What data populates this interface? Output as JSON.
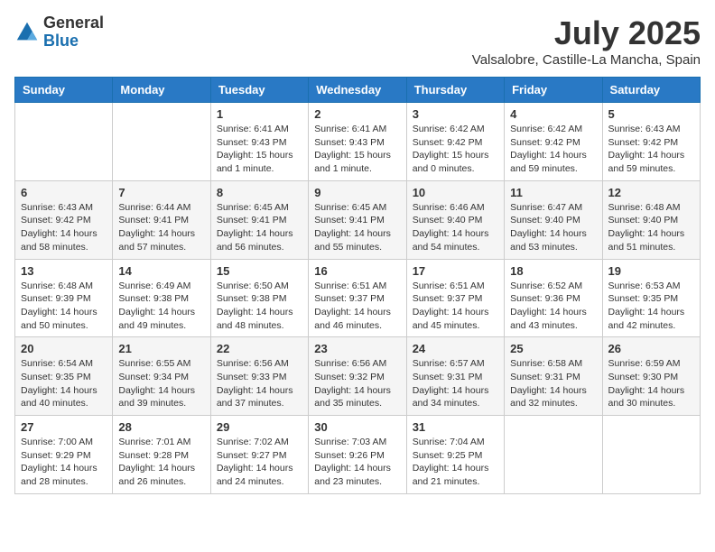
{
  "logo": {
    "general": "General",
    "blue": "Blue"
  },
  "title": "July 2025",
  "location": "Valsalobre, Castille-La Mancha, Spain",
  "days_of_week": [
    "Sunday",
    "Monday",
    "Tuesday",
    "Wednesday",
    "Thursday",
    "Friday",
    "Saturday"
  ],
  "weeks": [
    [
      {
        "day": "",
        "info": ""
      },
      {
        "day": "",
        "info": ""
      },
      {
        "day": "1",
        "info": "Sunrise: 6:41 AM\nSunset: 9:43 PM\nDaylight: 15 hours and 1 minute."
      },
      {
        "day": "2",
        "info": "Sunrise: 6:41 AM\nSunset: 9:43 PM\nDaylight: 15 hours and 1 minute."
      },
      {
        "day": "3",
        "info": "Sunrise: 6:42 AM\nSunset: 9:42 PM\nDaylight: 15 hours and 0 minutes."
      },
      {
        "day": "4",
        "info": "Sunrise: 6:42 AM\nSunset: 9:42 PM\nDaylight: 14 hours and 59 minutes."
      },
      {
        "day": "5",
        "info": "Sunrise: 6:43 AM\nSunset: 9:42 PM\nDaylight: 14 hours and 59 minutes."
      }
    ],
    [
      {
        "day": "6",
        "info": "Sunrise: 6:43 AM\nSunset: 9:42 PM\nDaylight: 14 hours and 58 minutes."
      },
      {
        "day": "7",
        "info": "Sunrise: 6:44 AM\nSunset: 9:41 PM\nDaylight: 14 hours and 57 minutes."
      },
      {
        "day": "8",
        "info": "Sunrise: 6:45 AM\nSunset: 9:41 PM\nDaylight: 14 hours and 56 minutes."
      },
      {
        "day": "9",
        "info": "Sunrise: 6:45 AM\nSunset: 9:41 PM\nDaylight: 14 hours and 55 minutes."
      },
      {
        "day": "10",
        "info": "Sunrise: 6:46 AM\nSunset: 9:40 PM\nDaylight: 14 hours and 54 minutes."
      },
      {
        "day": "11",
        "info": "Sunrise: 6:47 AM\nSunset: 9:40 PM\nDaylight: 14 hours and 53 minutes."
      },
      {
        "day": "12",
        "info": "Sunrise: 6:48 AM\nSunset: 9:40 PM\nDaylight: 14 hours and 51 minutes."
      }
    ],
    [
      {
        "day": "13",
        "info": "Sunrise: 6:48 AM\nSunset: 9:39 PM\nDaylight: 14 hours and 50 minutes."
      },
      {
        "day": "14",
        "info": "Sunrise: 6:49 AM\nSunset: 9:38 PM\nDaylight: 14 hours and 49 minutes."
      },
      {
        "day": "15",
        "info": "Sunrise: 6:50 AM\nSunset: 9:38 PM\nDaylight: 14 hours and 48 minutes."
      },
      {
        "day": "16",
        "info": "Sunrise: 6:51 AM\nSunset: 9:37 PM\nDaylight: 14 hours and 46 minutes."
      },
      {
        "day": "17",
        "info": "Sunrise: 6:51 AM\nSunset: 9:37 PM\nDaylight: 14 hours and 45 minutes."
      },
      {
        "day": "18",
        "info": "Sunrise: 6:52 AM\nSunset: 9:36 PM\nDaylight: 14 hours and 43 minutes."
      },
      {
        "day": "19",
        "info": "Sunrise: 6:53 AM\nSunset: 9:35 PM\nDaylight: 14 hours and 42 minutes."
      }
    ],
    [
      {
        "day": "20",
        "info": "Sunrise: 6:54 AM\nSunset: 9:35 PM\nDaylight: 14 hours and 40 minutes."
      },
      {
        "day": "21",
        "info": "Sunrise: 6:55 AM\nSunset: 9:34 PM\nDaylight: 14 hours and 39 minutes."
      },
      {
        "day": "22",
        "info": "Sunrise: 6:56 AM\nSunset: 9:33 PM\nDaylight: 14 hours and 37 minutes."
      },
      {
        "day": "23",
        "info": "Sunrise: 6:56 AM\nSunset: 9:32 PM\nDaylight: 14 hours and 35 minutes."
      },
      {
        "day": "24",
        "info": "Sunrise: 6:57 AM\nSunset: 9:31 PM\nDaylight: 14 hours and 34 minutes."
      },
      {
        "day": "25",
        "info": "Sunrise: 6:58 AM\nSunset: 9:31 PM\nDaylight: 14 hours and 32 minutes."
      },
      {
        "day": "26",
        "info": "Sunrise: 6:59 AM\nSunset: 9:30 PM\nDaylight: 14 hours and 30 minutes."
      }
    ],
    [
      {
        "day": "27",
        "info": "Sunrise: 7:00 AM\nSunset: 9:29 PM\nDaylight: 14 hours and 28 minutes."
      },
      {
        "day": "28",
        "info": "Sunrise: 7:01 AM\nSunset: 9:28 PM\nDaylight: 14 hours and 26 minutes."
      },
      {
        "day": "29",
        "info": "Sunrise: 7:02 AM\nSunset: 9:27 PM\nDaylight: 14 hours and 24 minutes."
      },
      {
        "day": "30",
        "info": "Sunrise: 7:03 AM\nSunset: 9:26 PM\nDaylight: 14 hours and 23 minutes."
      },
      {
        "day": "31",
        "info": "Sunrise: 7:04 AM\nSunset: 9:25 PM\nDaylight: 14 hours and 21 minutes."
      },
      {
        "day": "",
        "info": ""
      },
      {
        "day": "",
        "info": ""
      }
    ]
  ]
}
